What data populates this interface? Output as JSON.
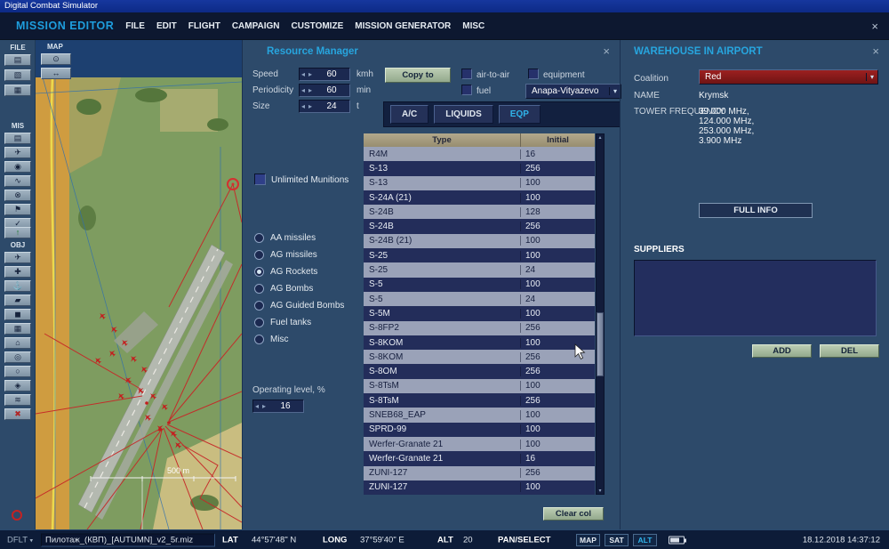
{
  "icons": {
    "close": "×",
    "dropdown_arrow": "▾",
    "stepper_left": "◂",
    "stepper_right": "▸",
    "scroll_up": "▴",
    "scroll_down": "▾",
    "profile_arrow": "▾"
  },
  "window": {
    "title": "Digital Combat Simulator"
  },
  "menu": {
    "app_title": "MISSION EDITOR",
    "items": [
      "FILE",
      "EDIT",
      "FLIGHT",
      "CAMPAIGN",
      "CUSTOMIZE",
      "MISSION GENERATOR",
      "MISC"
    ]
  },
  "toolbar": {
    "file_label": "FILE",
    "map_label": "MAP",
    "mis_label": "MIS",
    "obj_label": "OBJ",
    "file_icons": [
      {
        "name": "new-mission-icon",
        "glyph": "▤"
      },
      {
        "name": "open-mission-icon",
        "glyph": "▧"
      },
      {
        "name": "save-mission-icon",
        "glyph": "▦"
      }
    ],
    "map_icons": [
      {
        "name": "map-options-icon",
        "glyph": "⊙"
      },
      {
        "name": "distance-tool-icon",
        "glyph": "↔"
      }
    ],
    "mis_icons": [
      {
        "name": "briefing-icon",
        "glyph": "▤"
      },
      {
        "name": "sortie-icon",
        "glyph": "✈"
      },
      {
        "name": "sound-icon",
        "glyph": "◉"
      },
      {
        "name": "weather-icon",
        "glyph": "∿"
      },
      {
        "name": "failures-icon",
        "glyph": "⊗"
      },
      {
        "name": "triggers-icon",
        "glyph": "⚑"
      },
      {
        "name": "goals-icon",
        "glyph": "✓"
      }
    ],
    "fly_icon": {
      "name": "fly-mission-icon",
      "glyph": "↑"
    },
    "obj_icons": [
      {
        "name": "aircraft-icon",
        "glyph": "✈"
      },
      {
        "name": "helicopter-icon",
        "glyph": "✚"
      },
      {
        "name": "ship-icon",
        "glyph": "⚓"
      },
      {
        "name": "vehicle-icon",
        "glyph": "▰"
      },
      {
        "name": "static-object-icon",
        "glyph": "◼"
      },
      {
        "name": "template-icon",
        "glyph": "▦"
      },
      {
        "name": "farp-icon",
        "glyph": "⌂"
      },
      {
        "name": "airfield-icon",
        "glyph": "◎"
      },
      {
        "name": "trigger-zone-icon",
        "glyph": "○"
      },
      {
        "name": "initial-point-icon",
        "glyph": "◈"
      },
      {
        "name": "sealift-icon",
        "glyph": "≋"
      },
      {
        "name": "delete-object-icon",
        "glyph": "✖",
        "tint": "#b02525"
      }
    ]
  },
  "map": {
    "scale_label": "500 m"
  },
  "resource_manager": {
    "title": "Resource Manager",
    "fields": [
      {
        "label": "Speed",
        "value": "60",
        "unit": "kmh"
      },
      {
        "label": "Periodicity",
        "value": "60",
        "unit": "min"
      },
      {
        "label": "Size",
        "value": "24",
        "unit": "t"
      }
    ],
    "copy_to_label": "Copy to",
    "checkboxes": [
      {
        "label": "air-to-air",
        "checked": false
      },
      {
        "label": "equipment",
        "checked": false
      },
      {
        "label": "fuel",
        "checked": false
      }
    ],
    "airport_select": "Anapa-Vityazevo",
    "tabs": [
      {
        "label": "A/C",
        "active": false
      },
      {
        "label": "LIQUIDS",
        "active": false
      },
      {
        "label": "EQP",
        "active": true
      }
    ],
    "unlimited_label": "Unlimited Munitions",
    "categories": [
      {
        "label": "AA missiles",
        "selected": false
      },
      {
        "label": "AG missiles",
        "selected": false
      },
      {
        "label": "AG Rockets",
        "selected": true
      },
      {
        "label": "AG Bombs",
        "selected": false
      },
      {
        "label": "AG Guided Bombs",
        "selected": false
      },
      {
        "label": "Fuel tanks",
        "selected": false
      },
      {
        "label": "Misc",
        "selected": false
      }
    ],
    "operating_level": {
      "label": "Operating level, %",
      "value": "16"
    },
    "table": {
      "columns": [
        "Type",
        "Initial"
      ],
      "rows": [
        [
          "R4M",
          "16"
        ],
        [
          "S-13",
          "256"
        ],
        [
          "S-13",
          "100"
        ],
        [
          "S-24A (21)",
          "100"
        ],
        [
          "S-24B",
          "128"
        ],
        [
          "S-24B",
          "256"
        ],
        [
          "S-24B (21)",
          "100"
        ],
        [
          "S-25",
          "100"
        ],
        [
          "S-25",
          "24"
        ],
        [
          "S-5",
          "100"
        ],
        [
          "S-5",
          "24"
        ],
        [
          "S-5M",
          "100"
        ],
        [
          "S-8FP2",
          "256"
        ],
        [
          "S-8KOM",
          "100"
        ],
        [
          "S-8KOM",
          "256"
        ],
        [
          "S-8OM",
          "256"
        ],
        [
          "S-8TsM",
          "100"
        ],
        [
          "S-8TsM",
          "256"
        ],
        [
          "SNEB68_EAP",
          "100"
        ],
        [
          "SPRD-99",
          "100"
        ],
        [
          "Werfer-Granate 21",
          "100"
        ],
        [
          "Werfer-Granate 21",
          "16"
        ],
        [
          "ZUNI-127",
          "256"
        ],
        [
          "ZUNI-127",
          "100"
        ]
      ]
    },
    "clear_col_label": "Clear col"
  },
  "warehouse": {
    "title": "WAREHOUSE IN AIRPORT",
    "coalition_label": "Coalition",
    "coalition_value": "Red",
    "name_label": "NAME",
    "name_value": "Krymsk",
    "tower_label": "TOWER FREQUENCY",
    "tower_frequencies": [
      "39.000 MHz,",
      "124.000 MHz,",
      "253.000 MHz,",
      "3.900 MHz"
    ],
    "full_info_label": "FULL INFO",
    "suppliers_label": "SUPPLIERS",
    "add_label": "ADD",
    "del_label": "DEL"
  },
  "status_bar": {
    "profile": "DFLT",
    "mission_name": "Пилотаж_(КВП)_[AUTUMN]_v2_5r.miz",
    "lat_label": "LAT",
    "lat_value": "44°57'48\" N",
    "long_label": "LONG",
    "long_value": "37°59'40\" E",
    "alt_label": "ALT",
    "alt_value": "20",
    "mode_label": "PAN/SELECT",
    "buttons": [
      {
        "label": "MAP",
        "active": false
      },
      {
        "label": "SAT",
        "active": false
      },
      {
        "label": "ALT",
        "active": true
      }
    ],
    "datetime": "18.12.2018 14:37:12"
  }
}
